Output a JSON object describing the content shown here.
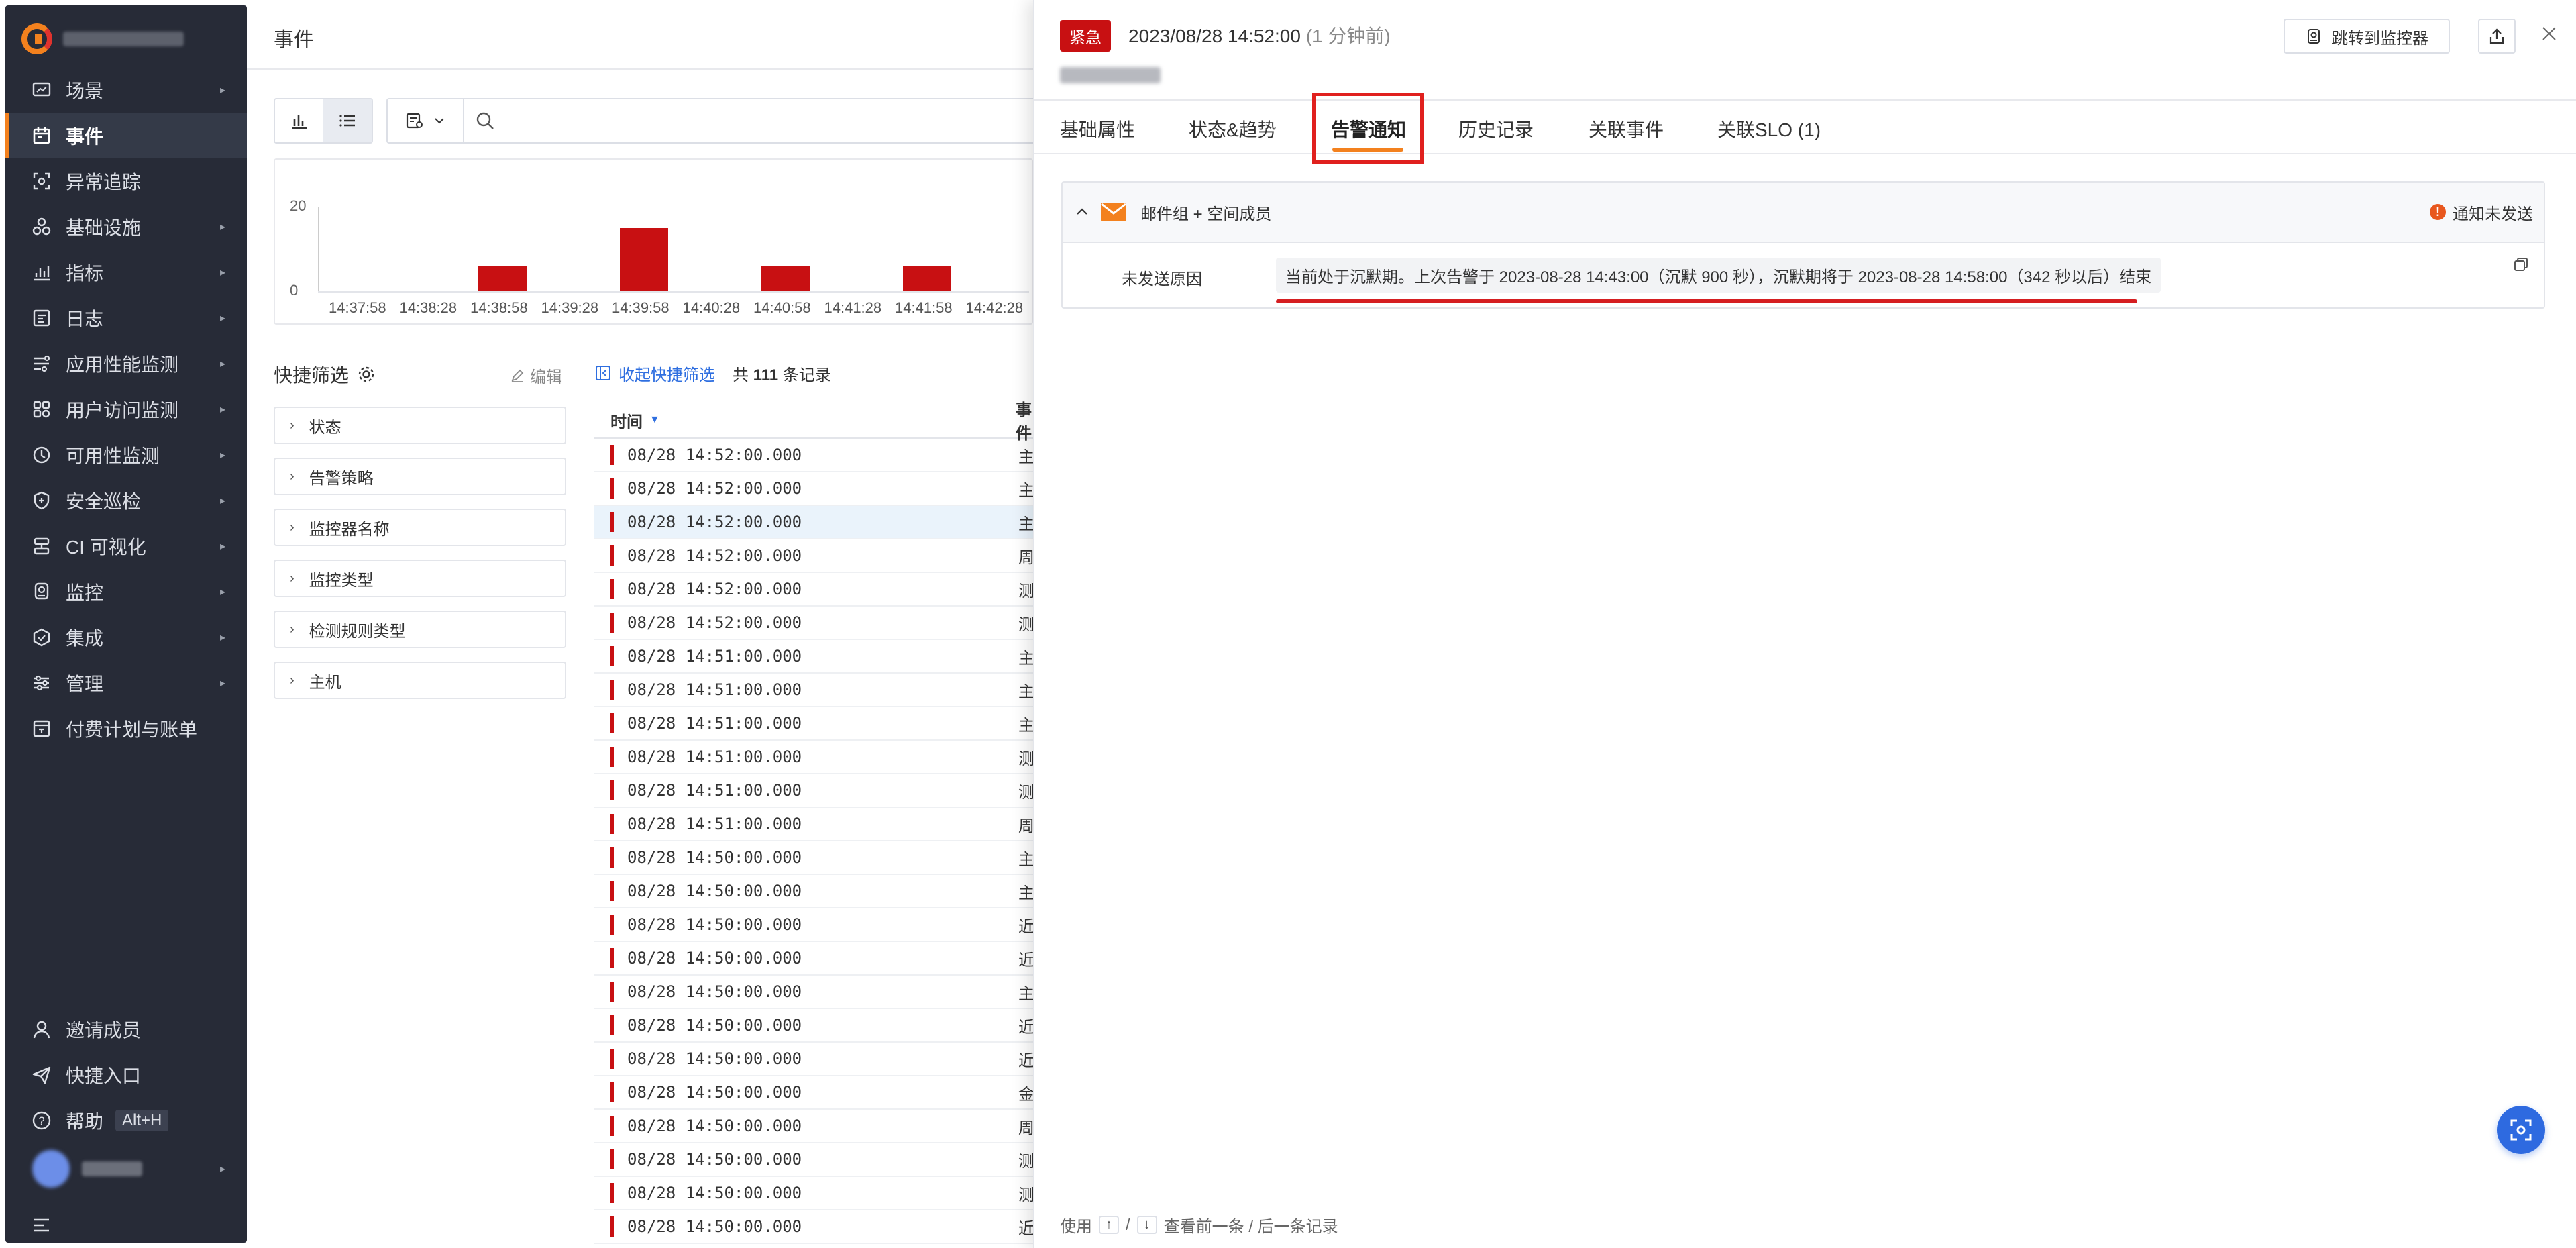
{
  "sidebar": {
    "logo_icon": "brand-logo-icon",
    "items": [
      {
        "label": "场景",
        "icon": "scene-icon",
        "arrow": true
      },
      {
        "label": "事件",
        "icon": "calendar-icon",
        "arrow": false,
        "active": true
      },
      {
        "label": "异常追踪",
        "icon": "scan-icon",
        "arrow": false
      },
      {
        "label": "基础设施",
        "icon": "infrastructure-icon",
        "arrow": true
      },
      {
        "label": "指标",
        "icon": "chart-icon",
        "arrow": true
      },
      {
        "label": "日志",
        "icon": "log-icon",
        "arrow": true
      },
      {
        "label": "应用性能监测",
        "icon": "apm-icon",
        "arrow": true
      },
      {
        "label": "用户访问监测",
        "icon": "rum-icon",
        "arrow": true
      },
      {
        "label": "可用性监测",
        "icon": "availability-icon",
        "arrow": true
      },
      {
        "label": "安全巡检",
        "icon": "shield-icon",
        "arrow": true
      },
      {
        "label": "CI 可视化",
        "icon": "ci-icon",
        "arrow": true
      },
      {
        "label": "监控",
        "icon": "monitor-icon",
        "arrow": true
      },
      {
        "label": "集成",
        "icon": "integration-icon",
        "arrow": true
      },
      {
        "label": "管理",
        "icon": "settings-sliders-icon",
        "arrow": true
      },
      {
        "label": "付费计划与账单",
        "icon": "billing-icon",
        "arrow": false
      }
    ],
    "bottom": {
      "invite": "邀请成员",
      "shortcut": "快捷入口",
      "help": "帮助",
      "help_key": "Alt+H"
    }
  },
  "page": {
    "title": "事件",
    "search_placeholder": ""
  },
  "histogram": {
    "y_ticks": [
      "20",
      "0"
    ],
    "x_ticks": [
      "14:37:58",
      "14:38:28",
      "14:38:58",
      "14:39:28",
      "14:39:58",
      "14:40:28",
      "14:40:58",
      "14:41:28",
      "14:41:58",
      "14:42:28"
    ],
    "bar_color": "#c81012",
    "bars": [
      {
        "x": "14:38:58",
        "value": 6
      },
      {
        "x": "14:39:58",
        "value": 15
      },
      {
        "x": "14:40:58",
        "value": 6
      },
      {
        "x": "14:41:58",
        "value": 6
      }
    ]
  },
  "filters": {
    "title": "快捷筛选",
    "edit": "编辑",
    "items": [
      "状态",
      "告警策略",
      "监控器名称",
      "监控类型",
      "检测规则类型",
      "主机"
    ]
  },
  "list": {
    "collapse_label": "收起快捷筛选",
    "count_prefix": "共",
    "count": "111",
    "count_suffix": "条记录",
    "col_time": "时间",
    "col_event": "事件",
    "rows": [
      {
        "time": "08/28 14:52:00.000",
        "event": "主"
      },
      {
        "time": "08/28 14:52:00.000",
        "event": "主"
      },
      {
        "time": "08/28 14:52:00.000",
        "event": "主",
        "highlight": true
      },
      {
        "time": "08/28 14:52:00.000",
        "event": "周"
      },
      {
        "time": "08/28 14:52:00.000",
        "event": "测"
      },
      {
        "time": "08/28 14:52:00.000",
        "event": "测"
      },
      {
        "time": "08/28 14:51:00.000",
        "event": "主"
      },
      {
        "time": "08/28 14:51:00.000",
        "event": "主"
      },
      {
        "time": "08/28 14:51:00.000",
        "event": "主"
      },
      {
        "time": "08/28 14:51:00.000",
        "event": "测"
      },
      {
        "time": "08/28 14:51:00.000",
        "event": "测"
      },
      {
        "time": "08/28 14:51:00.000",
        "event": "周"
      },
      {
        "time": "08/28 14:50:00.000",
        "event": "主"
      },
      {
        "time": "08/28 14:50:00.000",
        "event": "主"
      },
      {
        "time": "08/28 14:50:00.000",
        "event": "近"
      },
      {
        "time": "08/28 14:50:00.000",
        "event": "近"
      },
      {
        "time": "08/28 14:50:00.000",
        "event": "主"
      },
      {
        "time": "08/28 14:50:00.000",
        "event": "近"
      },
      {
        "time": "08/28 14:50:00.000",
        "event": "近"
      },
      {
        "time": "08/28 14:50:00.000",
        "event": "金"
      },
      {
        "time": "08/28 14:50:00.000",
        "event": "周"
      },
      {
        "time": "08/28 14:50:00.000",
        "event": "测"
      },
      {
        "time": "08/28 14:50:00.000",
        "event": "测"
      },
      {
        "time": "08/28 14:50:00.000",
        "event": "近"
      }
    ]
  },
  "drawer": {
    "severity": "紧急",
    "severity_color": "#c81012",
    "time": "2023/08/28 14:52:00",
    "ago": "(1 分钟前)",
    "goto_monitor": "跳转到监控器",
    "tabs": [
      "基础属性",
      "状态&趋势",
      "告警通知",
      "历史记录",
      "关联事件",
      "关联SLO (1)"
    ],
    "active_tab": "告警通知",
    "notification": {
      "channel": "邮件组 + 空间成员",
      "status": "通知未发送",
      "reason_label": "未发送原因",
      "reason_text": "当前处于沉默期。上次告警于 2023-08-28 14:43:00（沉默 900 秒），沉默期将于 2023-08-28 14:58:00（342 秒以后）结束"
    },
    "footer": {
      "prefix": "使用",
      "up": "↑",
      "sep": "/",
      "down": "↓",
      "suffix": "查看前一条 / 后一条记录"
    }
  }
}
